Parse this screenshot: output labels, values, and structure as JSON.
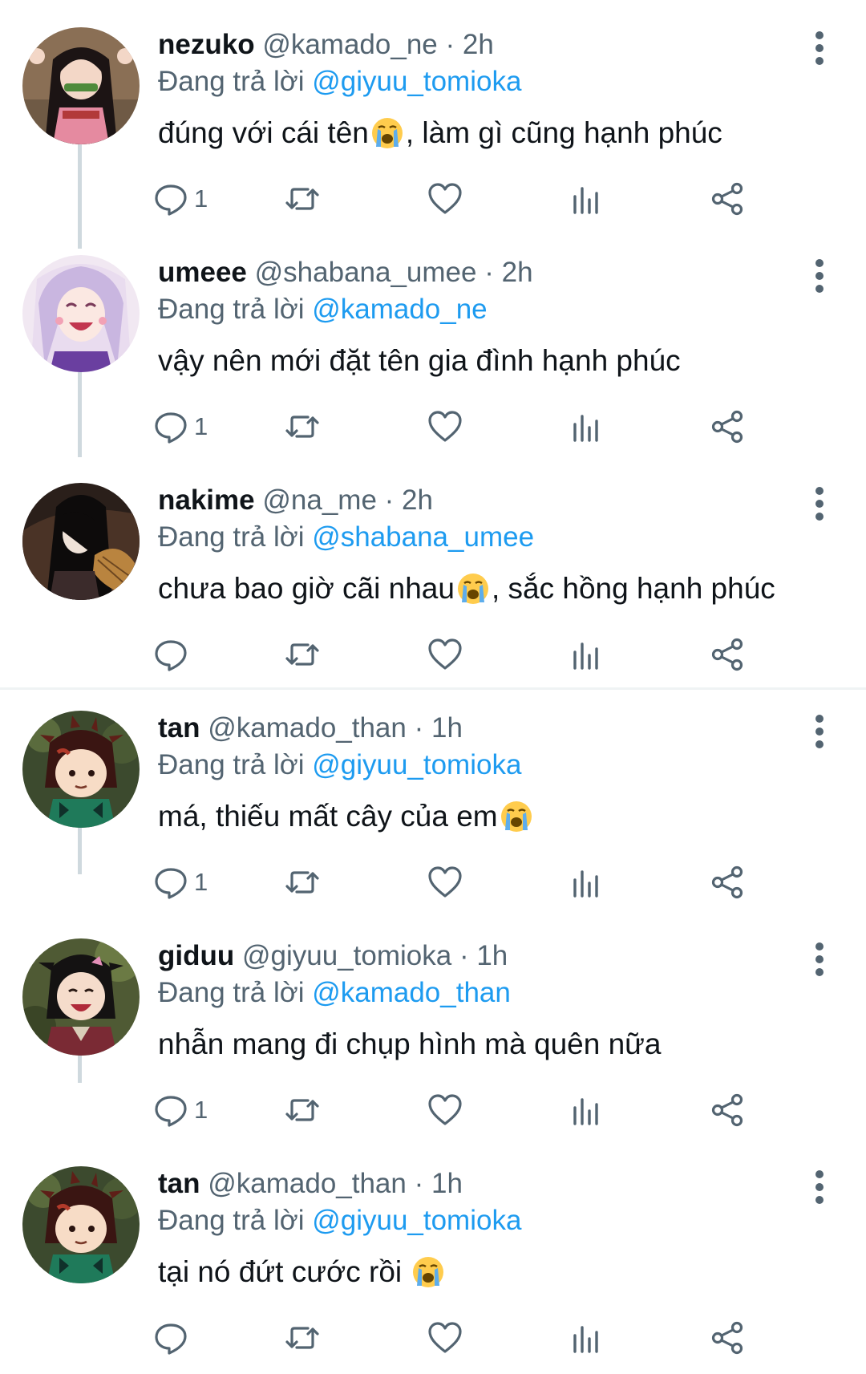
{
  "reply_prefix": "Đang trả lời",
  "tweets": [
    {
      "name": "nezuko",
      "handle": "@kamado_ne",
      "time": "· 2h",
      "reply_to": "@giyuu_tomioka",
      "text_before": "đúng với cái tên",
      "emoji": "loudly-crying-face",
      "text_after": ", làm gì cũng hạnh phúc",
      "reply_count": "1"
    },
    {
      "name": "umeee",
      "handle": "@shabana_umee",
      "time": "· 2h",
      "reply_to": "@kamado_ne",
      "text_before": "vậy nên mới đặt tên gia đình hạnh phúc",
      "emoji": "",
      "text_after": "",
      "reply_count": "1"
    },
    {
      "name": "nakime",
      "handle": "@na_me",
      "time": "· 2h",
      "reply_to": "@shabana_umee",
      "text_before": "chưa bao giờ cãi nhau",
      "emoji": "loudly-crying-face",
      "text_after": ", sắc hồng hạnh phúc",
      "reply_count": ""
    },
    {
      "name": "tan",
      "handle": "@kamado_than",
      "time": "· 1h",
      "reply_to": "@giyuu_tomioka",
      "text_before": "má, thiếu mất cây của em",
      "emoji": "loudly-crying-face",
      "text_after": "",
      "reply_count": "1"
    },
    {
      "name": "giduu",
      "handle": "@giyuu_tomioka",
      "time": "· 1h",
      "reply_to": "@kamado_than",
      "text_before": "nhẫn mang đi chụp hình mà quên nữa",
      "emoji": "",
      "text_after": "",
      "reply_count": "1"
    },
    {
      "name": "tan",
      "handle": "@kamado_than",
      "time": "· 1h",
      "reply_to": "@giyuu_tomioka",
      "text_before": "tại nó đứt cước rồi ",
      "emoji": "loudly-crying-face",
      "text_after": "",
      "reply_count": ""
    }
  ],
  "colors": {
    "accent": "#1d9bf0",
    "text": "#0f1419",
    "secondary": "#536471",
    "thread_line": "#cfd9de",
    "separator": "#eff3f4",
    "background": "#ffffff"
  },
  "icons": {
    "reply": "reply-bubble-icon",
    "retweet": "retweet-icon",
    "like": "heart-icon",
    "views": "views-bar-chart-icon",
    "share": "share-icon",
    "more": "more-vertical-dots-icon"
  }
}
